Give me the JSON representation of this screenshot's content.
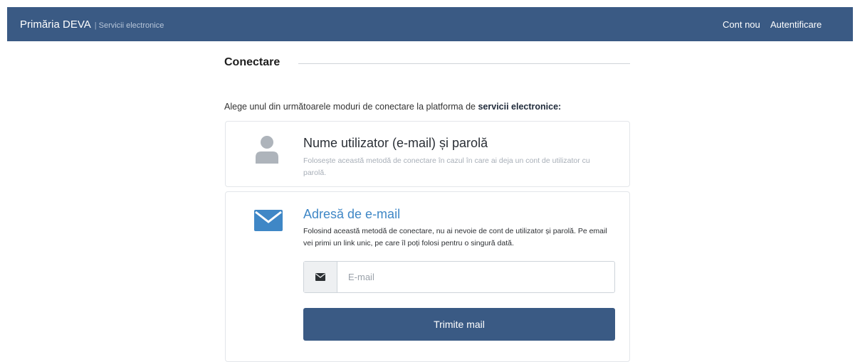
{
  "navbar": {
    "brand_name": "Primăria DEVA",
    "brand_separator": "|",
    "brand_subtitle": "Servicii electronice",
    "links": {
      "register": "Cont nou",
      "login": "Autentificare"
    },
    "color": "#3a5a84"
  },
  "main": {
    "title": "Conectare",
    "intro_text": "Alege unul din următoarele moduri de conectare la platforma de ",
    "intro_bold": "servicii electronice:",
    "methods": [
      {
        "icon": "user-icon",
        "title": "Nume utilizator (e-mail) și parolă",
        "description": "Folosește această metodă de conectare în cazul în care ai deja un cont de utilizator cu parolă."
      },
      {
        "icon": "envelope-icon",
        "title": "Adresă de e-mail",
        "description": "Folosind această metodă de conectare, nu ai nevoie de cont de utilizator și parolă. Pe email vei primi un link unic, pe care îl poți folosi pentru o singură dată.",
        "email_input": {
          "placeholder": "E-mail",
          "value": ""
        },
        "submit_label": "Trimite mail"
      }
    ]
  },
  "colors": {
    "accent": "#3f87c6",
    "muted_text": "#a8afb8"
  }
}
